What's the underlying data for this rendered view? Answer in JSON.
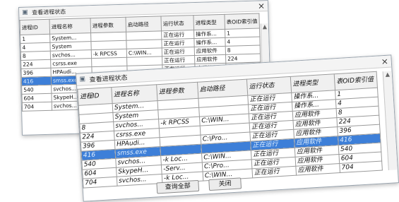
{
  "window_title": "查看进程状态",
  "close_glyph": "×",
  "columns": [
    "进程ID",
    "进程名称",
    "进程参数",
    "启动路径",
    "运行状态",
    "进程类型",
    "表OID索引值"
  ],
  "back_rows": [
    [
      "1",
      "System...",
      "",
      "",
      "正在运行",
      "操作系...",
      "1"
    ],
    [
      "4",
      "System",
      "",
      "",
      "正在运行",
      "操作系...",
      "4"
    ],
    [
      "8",
      "svchos...",
      "-k RPCSS",
      "C:\\WIN...",
      "正在运行",
      "应用软件",
      "8"
    ],
    [
      "224",
      "csrss.exe",
      "",
      "",
      "正在运行",
      "应用软件",
      "224"
    ],
    [
      "396",
      "HPAudi...",
      "",
      "",
      "正在运行",
      "应用软件",
      "396"
    ],
    [
      "416",
      "smss.exe",
      "",
      "",
      "正在运行",
      "应用软件",
      "416"
    ],
    [
      "540",
      "svchos...",
      "",
      "",
      "",
      "",
      ""
    ],
    [
      "604",
      "SkypeH...",
      "",
      "",
      "",
      "",
      ""
    ],
    [
      "704",
      "svchos...",
      "",
      "",
      "",
      "",
      ""
    ]
  ],
  "front_rows": [
    [
      "",
      "System...",
      "",
      "",
      "正在运行",
      "操作系...",
      "1"
    ],
    [
      "",
      "System",
      "",
      "",
      "正在运行",
      "操作系...",
      "4"
    ],
    [
      "8",
      "svchos...",
      "-k RPCSS",
      "C:\\WIN...",
      "正在运行",
      "应用软件",
      "8"
    ],
    [
      "224",
      "csrss.exe",
      "",
      "",
      "正在运行",
      "应用软件",
      "224"
    ],
    [
      "396",
      "HPAudi...",
      "",
      "C:\\Pro...",
      "正在运行",
      "应用软件",
      "396"
    ],
    [
      "416",
      "smss.exe",
      "",
      "",
      "正在运行",
      "应用软件",
      "416"
    ],
    [
      "540",
      "svchos...",
      "-k Loc...",
      "C:\\WIN...",
      "正在运行",
      "应用软件",
      "540"
    ],
    [
      "604",
      "SkypeH...",
      "-Serv...",
      "C:\\Pro...",
      "正在运行",
      "应用软件",
      "604"
    ],
    [
      "704",
      "svchos...",
      "-k Loc...",
      "C:\\WIN...",
      "正在运行",
      "应用软件",
      "704"
    ]
  ],
  "selected_row_index": 5,
  "buttons": {
    "query_all": "查询全部",
    "close": "关闭"
  },
  "colors": {
    "selection": "#3d7fd8",
    "header_bg": "#f0f0f0"
  }
}
